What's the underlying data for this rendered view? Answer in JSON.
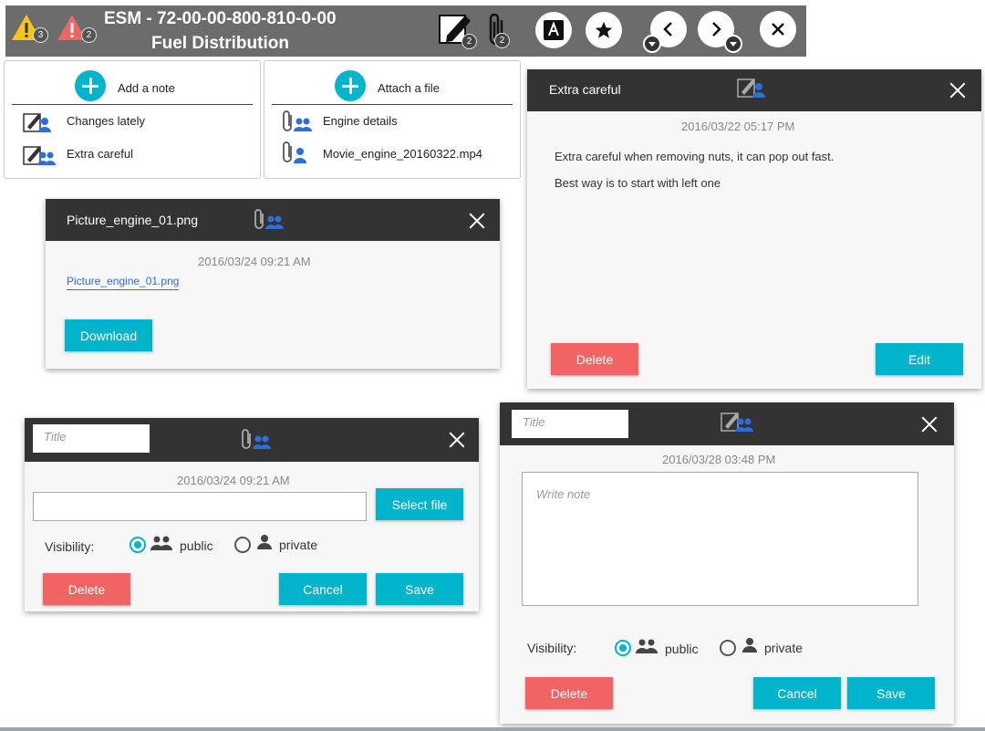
{
  "header": {
    "title_line1": "ESM - 72-00-00-800-810-0-00",
    "title_line2": "Fuel Distribution",
    "warning_yellow_count": "3",
    "warning_red_count": "2",
    "notes_count": "2",
    "attachments_count": "2"
  },
  "notes_panel": {
    "add_label": "Add a note",
    "items": [
      {
        "label": "Changes lately",
        "visibility": "private"
      },
      {
        "label": "Extra careful",
        "visibility": "public"
      }
    ]
  },
  "files_panel": {
    "add_label": "Attach a file",
    "items": [
      {
        "label": "Engine details",
        "visibility": "public"
      },
      {
        "label": "Movie_engine_20160322.mp4",
        "visibility": "private"
      }
    ]
  },
  "file_view_dialog": {
    "title": "Picture_engine_01.png",
    "timestamp": "2016/03/24   09:21 AM",
    "file_link": "Picture_engine_01.png",
    "download_label": "Download"
  },
  "note_view_dialog": {
    "title": "Extra careful",
    "timestamp": "2016/03/22   05:17 PM",
    "line1": "Extra careful when removing nuts, it can pop out fast.",
    "line2": "Best way is to start with left one",
    "delete_label": "Delete",
    "edit_label": "Edit"
  },
  "file_edit_dialog": {
    "title_placeholder": "Title",
    "timestamp": "2016/03/24   09:21 AM",
    "select_file_label": "Select file",
    "visibility_label": "Visibility:",
    "public_label": "public",
    "private_label": "private",
    "selected_visibility": "public",
    "delete_label": "Delete",
    "cancel_label": "Cancel",
    "save_label": "Save"
  },
  "note_edit_dialog": {
    "title_placeholder": "Title",
    "timestamp": "2016/03/28   03:48 PM",
    "note_placeholder": "Write note",
    "visibility_label": "Visibility:",
    "public_label": "public",
    "private_label": "private",
    "selected_visibility": "public",
    "delete_label": "Delete",
    "cancel_label": "Cancel",
    "save_label": "Save"
  },
  "colors": {
    "accent": "#00b4cc",
    "danger": "#f26464",
    "header_bg": "#6c6c6c",
    "dialog_header_bg": "#333333",
    "public_icon": "#2a6fdb"
  }
}
